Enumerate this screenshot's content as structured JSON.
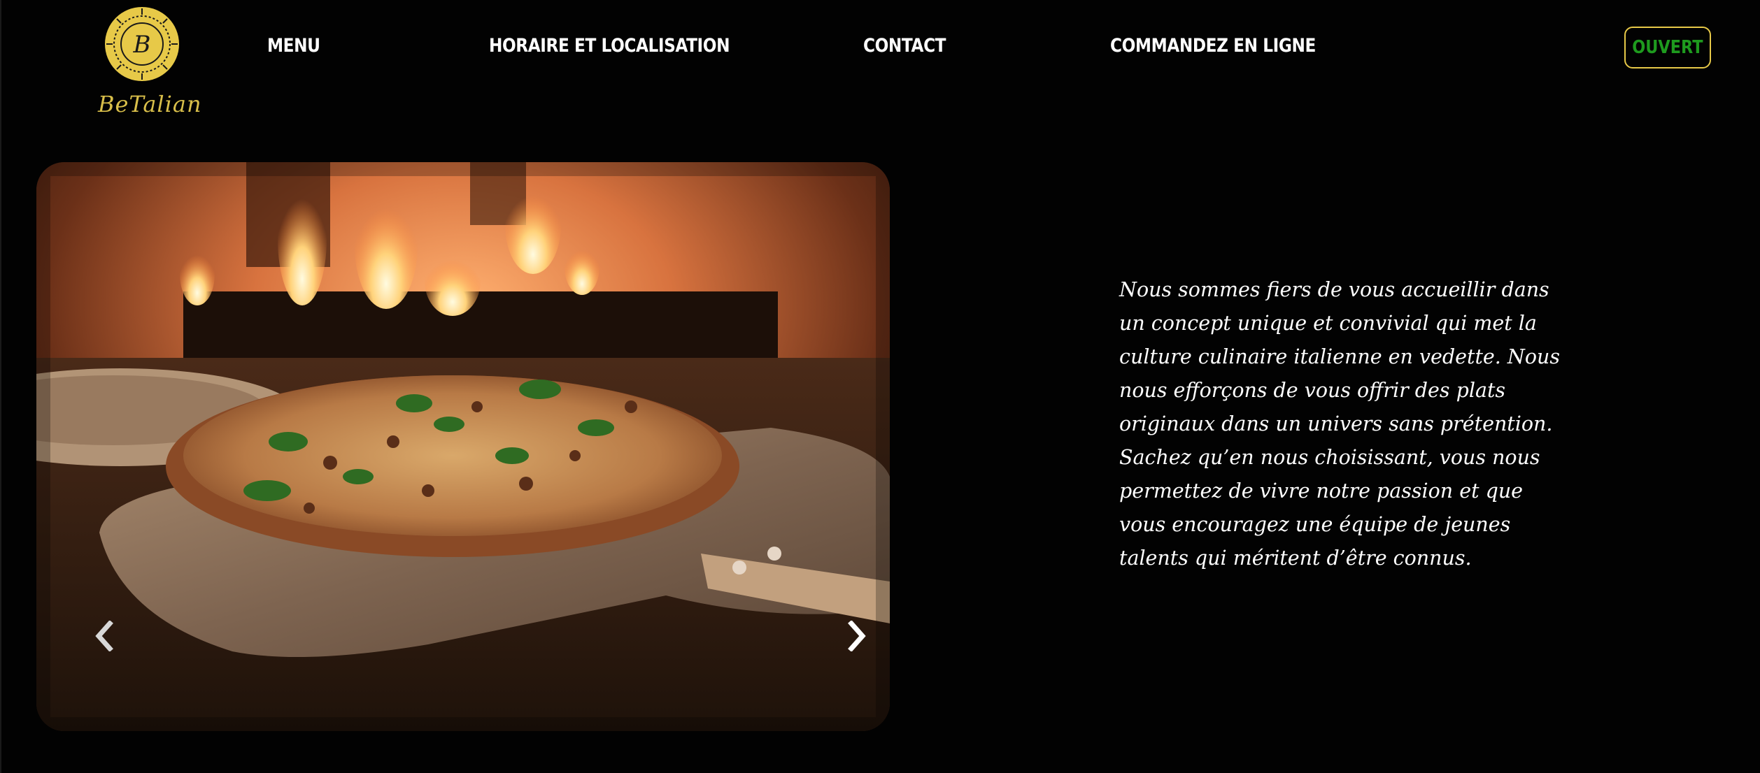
{
  "brand": {
    "logo_initial": "B",
    "logo_text": "BeTalian",
    "logo_icon": "pizza-sun-badge-icon",
    "accent_color": "#e7c948"
  },
  "nav": {
    "items": [
      {
        "label": "MENU"
      },
      {
        "label": "HORAIRE ET LOCALISATION"
      },
      {
        "label": "CONTACT"
      },
      {
        "label": "COMMANDEZ EN LIGNE"
      }
    ]
  },
  "status": {
    "label": "OUVERT",
    "color": "#1e9b1e",
    "border_color": "#e7c948"
  },
  "carousel": {
    "image_subject": "pizza-on-peel-wood-fired-oven",
    "prev_icon": "chevron-left-icon",
    "next_icon": "chevron-right-icon"
  },
  "intro": {
    "text": "Nous sommes fiers de vous accueillir dans un concept unique et convivial qui met la culture culinaire italienne en vedette. Nous nous efforçons de vous offrir des plats originaux dans un univers sans prétention. Sachez qu’en nous choisissant, vous nous permettez de vivre notre passion et que vous encouragez une équipe de jeunes talents qui méritent d’être connus."
  }
}
